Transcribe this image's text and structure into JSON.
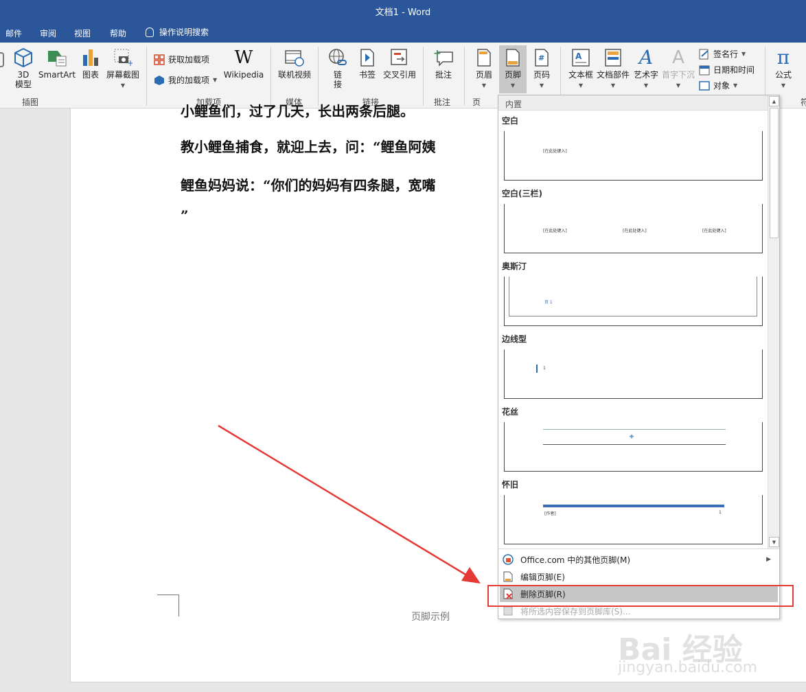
{
  "window": {
    "title": "文档1  -  Word"
  },
  "tabs": [
    "邮件",
    "审阅",
    "视图",
    "帮助"
  ],
  "tell_me": "操作说明搜索",
  "ribbon": {
    "model3d": "3D\n模型",
    "smartart": "SmartArt",
    "chart": "图表",
    "screenshot": "屏幕截图",
    "group_illustrations": "插图",
    "get_addins": "获取加载项",
    "my_addins": "我的加载项",
    "wikipedia": "Wikipedia",
    "group_addins": "加载项",
    "online_video": "联机视频",
    "group_media": "媒体",
    "link": "链\n接",
    "bookmark": "书签",
    "crossref": "交叉引用",
    "group_links": "链接",
    "comment": "批注",
    "group_comments": "批注",
    "header": "页眉",
    "footer": "页脚",
    "page_number": "页码",
    "group_hf_partial": "页",
    "textbox": "文本框",
    "quickparts": "文档部件",
    "wordart": "艺术字",
    "dropcap": "首字下沉",
    "signature": "签名行",
    "datetime": "日期和时间",
    "object": "对象",
    "equation": "公式",
    "symbol_partial": "符"
  },
  "document": {
    "line0": "小鲤鱼们，过了几天，长出两条后腿。",
    "line1": "教小鲤鱼捕食，就迎上去，问：“鲤鱼阿姨",
    "line2": "鲤鱼妈妈说：“你们的妈妈有四条腿，宽嘴",
    "line3": "”",
    "footer_sample": "页脚示例"
  },
  "gallery": {
    "section_header": "内置",
    "items": [
      {
        "label": "空白",
        "thumb_text": "[在此处键入]"
      },
      {
        "label": "空白(三栏)",
        "thumb_text": "[在此处键入]"
      },
      {
        "label": "奥斯汀",
        "thumb_text": "页 1"
      },
      {
        "label": "边线型",
        "thumb_text": "1"
      },
      {
        "label": "花丝",
        "thumb_text": ""
      },
      {
        "label": "怀旧",
        "thumb_text": "[作者]",
        "thumb_num": "1"
      }
    ]
  },
  "commands": [
    {
      "label": "Office.com 中的其他页脚(M)",
      "enabled": true
    },
    {
      "label": "编辑页脚(E)",
      "enabled": true
    },
    {
      "label": "删除页脚(R)",
      "enabled": true,
      "highlighted": true
    },
    {
      "label": "将所选内容保存到页脚库(S)...",
      "enabled": false
    }
  ],
  "watermark": {
    "brand": "Bai 经验",
    "url": "jingyan.baidu.com"
  },
  "colors": {
    "accent": "#2b579a",
    "annotation": "#e53935"
  }
}
